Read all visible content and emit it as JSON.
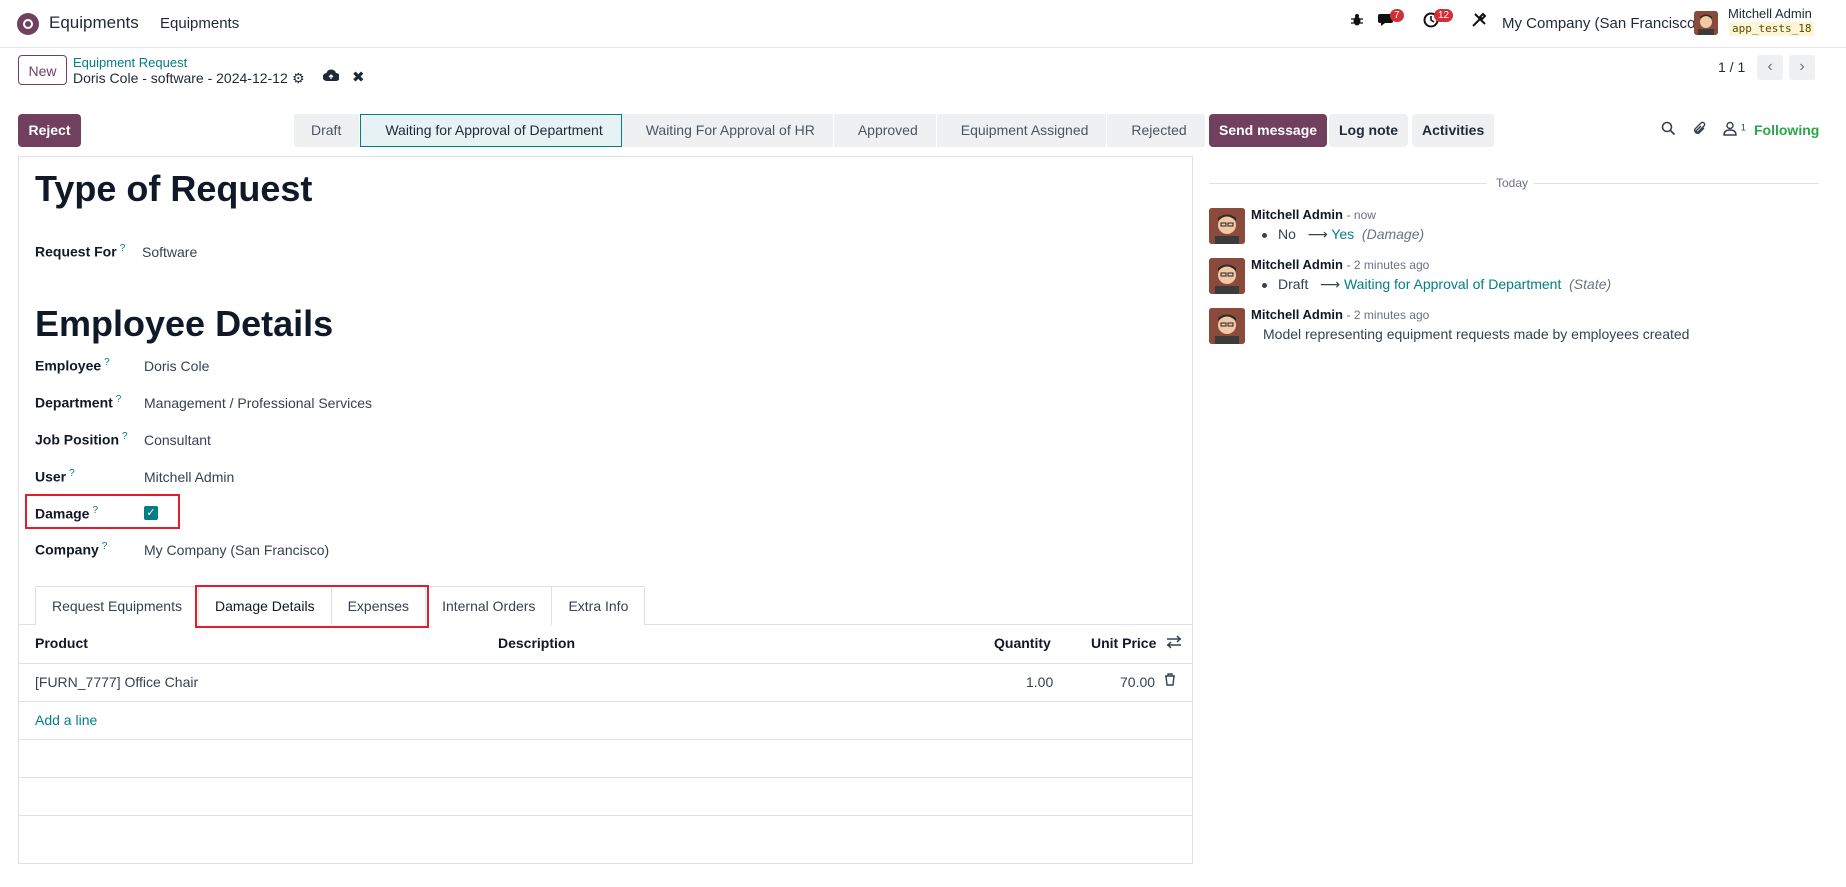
{
  "navbar": {
    "app_name": "Equipments",
    "menu_item": "Equipments",
    "messages_badge": "7",
    "activities_badge": "12",
    "company": "My Company (San Francisco)",
    "user_name": "Mitchell Admin",
    "database": "app_tests_18"
  },
  "control_panel": {
    "new_label": "New",
    "breadcrumb_parent": "Equipment Request",
    "breadcrumb_current": "Doris Cole - software - 2024-12-12",
    "pager": "1 / 1"
  },
  "statusbar": {
    "reject_label": "Reject",
    "stages": [
      "Draft",
      "Waiting for Approval of Department",
      "Waiting For Approval of HR",
      "Approved",
      "Equipment Assigned",
      "Rejected"
    ],
    "active_stage": "Waiting for Approval of Department"
  },
  "form": {
    "type_heading": "Type of Request",
    "employee_heading": "Employee Details",
    "help_mark": "?",
    "request_for": {
      "label": "Request For",
      "value": "Software"
    },
    "employee": {
      "label": "Employee",
      "value": "Doris Cole"
    },
    "department": {
      "label": "Department",
      "value": "Management / Professional Services"
    },
    "job_position": {
      "label": "Job Position",
      "value": "Consultant"
    },
    "user": {
      "label": "User",
      "value": "Mitchell Admin"
    },
    "damage": {
      "label": "Damage",
      "checked": true
    },
    "company": {
      "label": "Company",
      "value": "My Company (San Francisco)"
    }
  },
  "tabs": [
    "Request Equipments",
    "Damage Details",
    "Expenses",
    "Internal Orders",
    "Extra Info"
  ],
  "active_tab": "Damage Details",
  "table": {
    "headers": {
      "product": "Product",
      "description": "Description",
      "quantity": "Quantity",
      "unit_price": "Unit Price"
    },
    "rows": [
      {
        "product": "[FURN_7777] Office Chair",
        "description": "",
        "quantity": "1.00",
        "unit_price": "70.00"
      }
    ],
    "add_line": "Add a line"
  },
  "chatter": {
    "send_message": "Send message",
    "log_note": "Log note",
    "activities": "Activities",
    "followers_count": "1",
    "following": "Following",
    "date_separator": "Today",
    "messages": [
      {
        "author": "Mitchell Admin",
        "time": "- now",
        "old_value": "No",
        "arrow": "⟶",
        "new_value": "Yes",
        "field": "(Damage)"
      },
      {
        "author": "Mitchell Admin",
        "time": "- 2 minutes ago",
        "old_value": "Draft",
        "arrow": "⟶",
        "new_value": "Waiting for Approval of Department",
        "field": "(State)"
      },
      {
        "author": "Mitchell Admin",
        "time": "- 2 minutes ago",
        "body": "Model representing equipment requests made by employees created"
      }
    ]
  },
  "colors": {
    "brand": "#71405f",
    "accent": "#017e84",
    "highlight_box": "#e11d2e",
    "following": "#28a745"
  }
}
